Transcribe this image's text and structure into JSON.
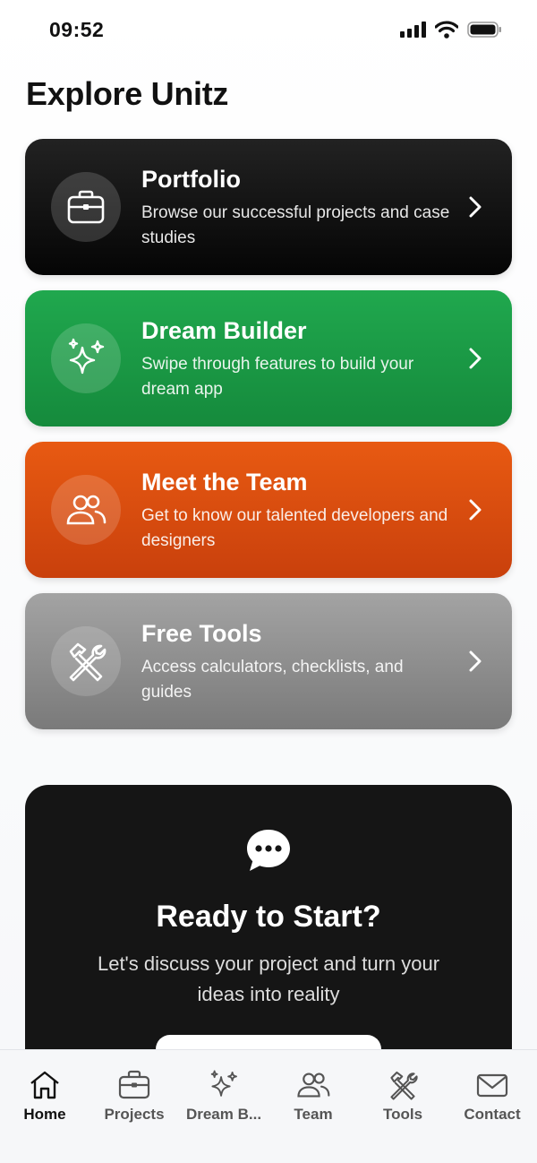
{
  "status_bar": {
    "time": "09:52"
  },
  "page": {
    "title": "Explore Unitz"
  },
  "cards": [
    {
      "title": "Portfolio",
      "description": "Browse our successful projects and case studies",
      "icon": "briefcase-icon",
      "gradient": [
        "#222222",
        "#050505"
      ]
    },
    {
      "title": "Dream Builder",
      "description": "Swipe through features to build your dream app",
      "icon": "sparkles-icon",
      "gradient": [
        "#20a84e",
        "#158a3c"
      ]
    },
    {
      "title": "Meet the Team",
      "description": "Get to know our talented developers and designers",
      "icon": "users-icon",
      "gradient": [
        "#e85a12",
        "#c9400c"
      ]
    },
    {
      "title": "Free Tools",
      "description": "Access calculators, checklists, and guides",
      "icon": "tools-icon",
      "gradient": [
        "#a3a3a3",
        "#7a7a7a"
      ]
    }
  ],
  "cta": {
    "icon": "chat-bubble-icon",
    "title": "Ready to Start?",
    "description": "Let's discuss your project and turn your ideas into reality"
  },
  "tab_bar": {
    "active": "Home",
    "tabs": [
      {
        "label": "Home",
        "icon": "home-icon"
      },
      {
        "label": "Projects",
        "icon": "briefcase-icon"
      },
      {
        "label": "Dream B...",
        "icon": "sparkles-icon"
      },
      {
        "label": "Team",
        "icon": "users-icon"
      },
      {
        "label": "Tools",
        "icon": "tools-icon"
      },
      {
        "label": "Contact",
        "icon": "mail-icon"
      }
    ]
  }
}
